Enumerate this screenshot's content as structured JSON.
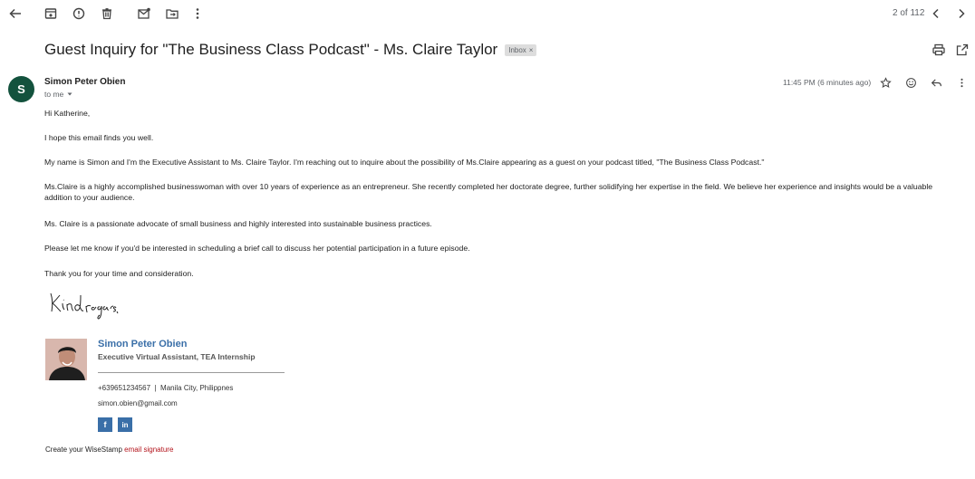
{
  "toolbar": {
    "icons": [
      "back-arrow-icon",
      "archive-icon",
      "report-spam-icon",
      "delete-icon",
      "mark-unread-icon",
      "move-to-icon",
      "more-vert-icon"
    ],
    "pager": "2 of 112"
  },
  "email": {
    "subject": "Guest Inquiry for \"The Business Class Podcast\" - Ms. Claire Taylor",
    "label": "Inbox",
    "label_close": "×",
    "sender_initial": "S",
    "sender_name": "Simon Peter Obien",
    "to": "to me",
    "timestamp": "11:45 PM (6 minutes ago)"
  },
  "body": {
    "greeting": "Hi Katherine,",
    "p1": "I hope this email finds you well.",
    "p2": "My name is Simon and I'm the Executive Assistant to Ms. Claire Taylor. I'm reaching out to inquire about the possibility of Ms.Claire appearing as a guest on your podcast titled, \"The Business Class Podcast.\"",
    "p3": "Ms.Claire is a highly accomplished businesswoman with over 10 years of experience as an entrepreneur. She recently completed her doctorate degree, further solidifying her expertise in the field. We believe her experience and insights would be a valuable addition to your audience.",
    "p4": "Ms. Claire is a passionate advocate of small business and highly interested into sustainable business practices.",
    "p5": "Please let me know if you'd be interested in scheduling a brief call to discuss her potential participation in a future episode.",
    "p6": "Thank you for your time and consideration."
  },
  "signature": {
    "handwritten": "Kind regards,",
    "name": "Simon Peter Obien",
    "title": "Executive Virtual Assistant, TEA Internship",
    "phone_location": "+639651234567  |  Manila City, Philippnes",
    "email": "simon.obien@gmail.com",
    "social": [
      {
        "label": "f"
      },
      {
        "label": "in"
      }
    ],
    "wisestamp_prefix": "Create your WiseStamp ",
    "wisestamp_link": "email signature"
  },
  "colors": {
    "avatar_bg": "#13523d",
    "signature_name": "#3a6fa8",
    "link_red": "#b3131b"
  }
}
